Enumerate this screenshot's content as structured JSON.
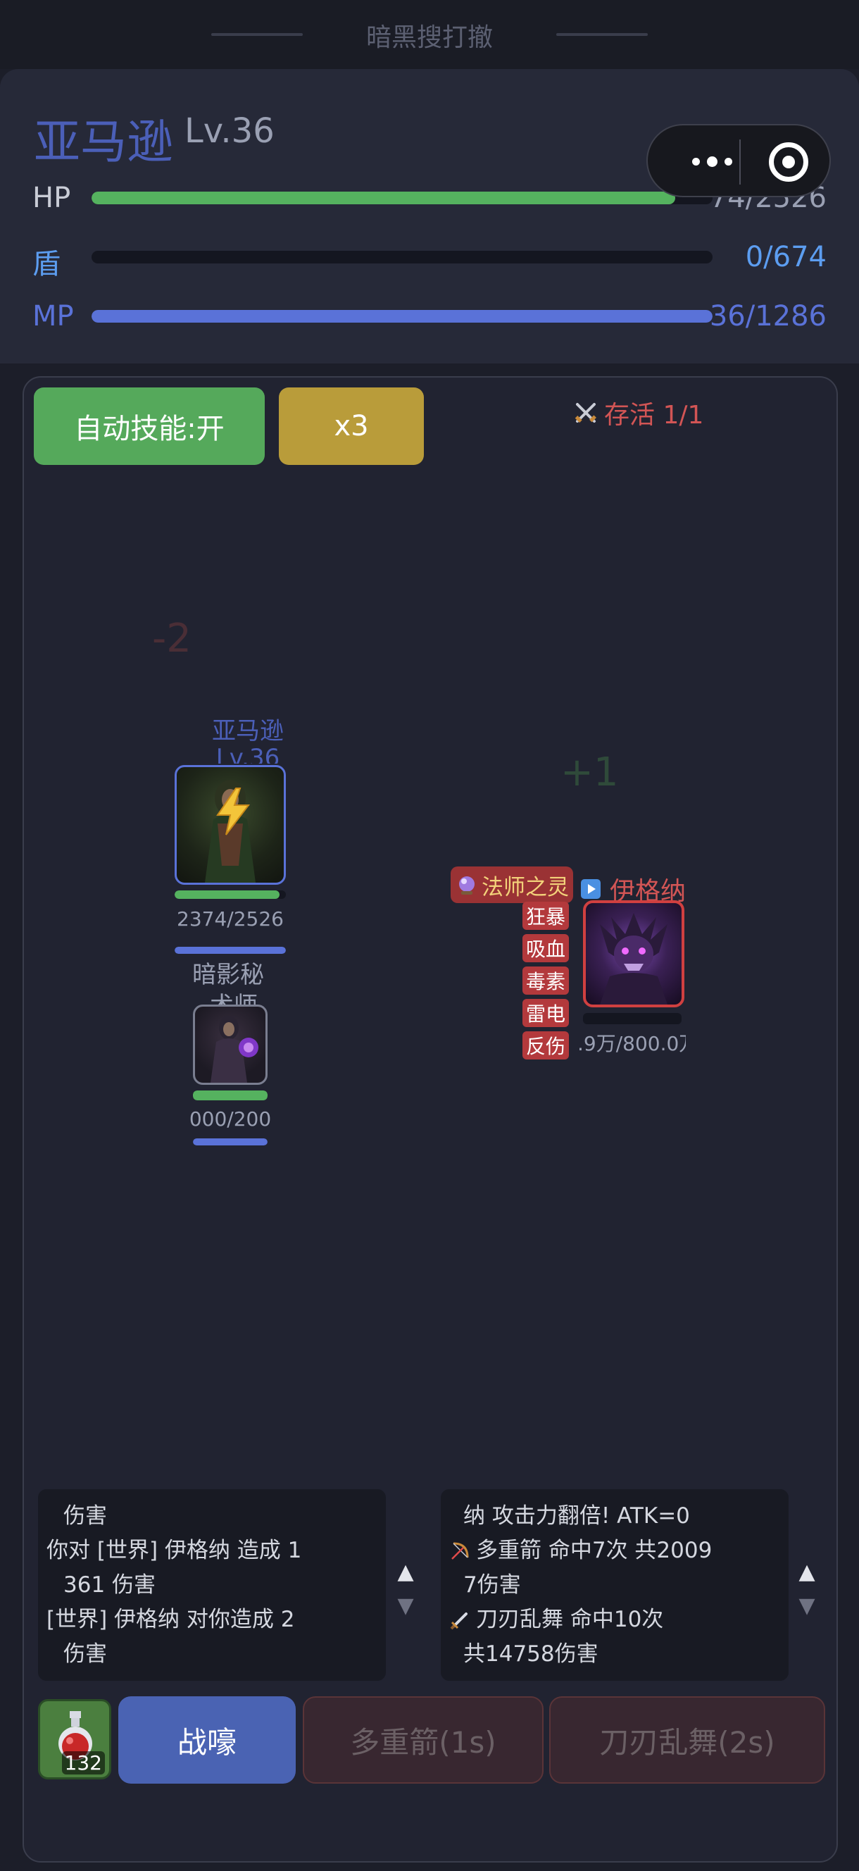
{
  "app": {
    "title": "暗黑搜打撤"
  },
  "player": {
    "name": "亚马逊",
    "level": "Lv.36",
    "hp": {
      "label": "HP",
      "value": "74/2526",
      "fill": 0.94,
      "color": "#55b25f"
    },
    "shield": {
      "label": "盾",
      "value": "0/674",
      "fill": 0.0,
      "color": "#5c9df0"
    },
    "mp": {
      "label": "MP",
      "value": "36/1286",
      "fill": 1.0,
      "color": "#5a72d8"
    }
  },
  "capsule": {
    "more_icon": "more-dots-icon",
    "close_icon": "target-icon"
  },
  "battle": {
    "auto_skill_label": "自动技能:开",
    "speed_label": "x3",
    "survive_label": "存活 1/1",
    "float_minus": "-2",
    "float_plus": "+1",
    "hero": {
      "name": "亚马逊",
      "level": "Lv.36",
      "hp_text": "2374/2526",
      "hp_fill": 0.94,
      "mp_fill": 1.0
    },
    "pet": {
      "name_line1": "暗影秘",
      "name_line2": "术师",
      "hp_text": "000/200",
      "hp_fill": 1.0,
      "mp_fill": 1.0
    },
    "enemy": {
      "title": "法师之灵",
      "name": "伊格纳",
      "hp_text": ".9万/800.0万",
      "hp_fill": 0.0,
      "buffs": [
        "狂暴",
        "吸血",
        "毒素",
        "雷电",
        "反伤"
      ]
    }
  },
  "log_left": [
    "伤害",
    "你对 [世界] 伊格纳 造成 1",
    "361 伤害",
    "[世界] 伊格纳 对你造成 2",
    "伤害"
  ],
  "log_right": [
    "纳 攻击力翻倍! ATK=0",
    "多重箭 命中7次 共2009",
    "7伤害",
    "刀刃乱舞 命中10次",
    "共14758伤害"
  ],
  "scroll": {
    "up": "▲",
    "down": "▼"
  },
  "potion": {
    "count": "132"
  },
  "skills": {
    "roar": "战嚎",
    "multishot": "多重箭(1s)",
    "blade": "刀刃乱舞(2s)"
  },
  "colors": {
    "accent_blue": "#4b5fb8",
    "danger": "#d25555",
    "auto_green": "#55a95b",
    "speed_gold": "#b99c3a"
  }
}
